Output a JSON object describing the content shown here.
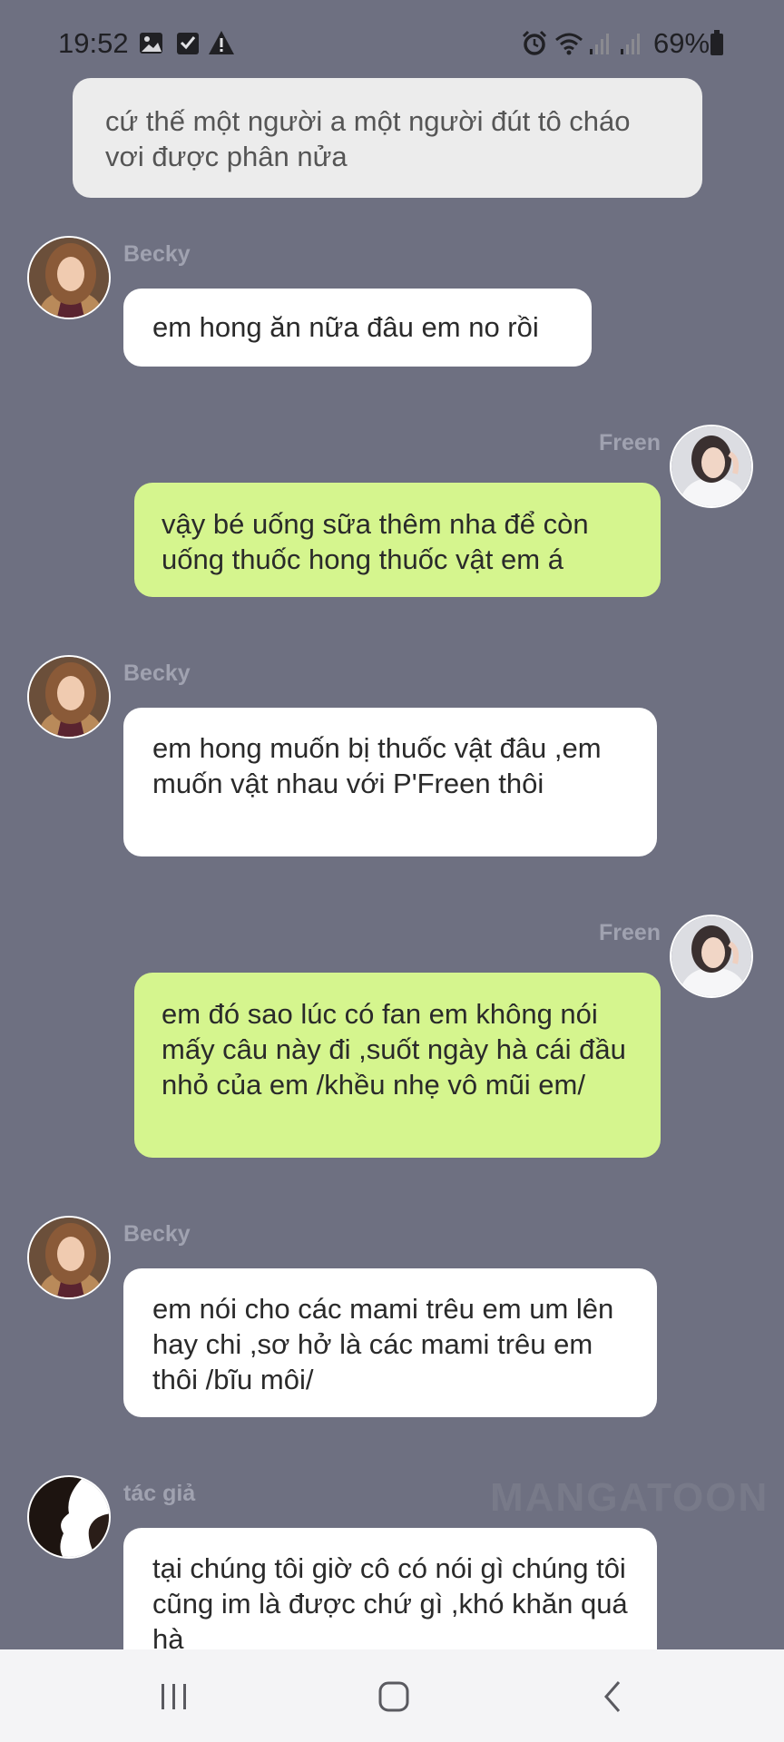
{
  "status_bar": {
    "time": "19:52",
    "battery": "69%",
    "icons_left": [
      "image-notification-icon",
      "checkbox-notification-icon",
      "warning-icon"
    ],
    "icons_right": [
      "alarm-icon",
      "wifi-icon",
      "signal-icon",
      "signal-icon",
      "battery-icon"
    ]
  },
  "messages": [
    {
      "type": "narration",
      "text": "cứ thế một người a một người đút tô cháo vơi được phân nửa"
    },
    {
      "type": "left",
      "sender": "Becky",
      "avatar": "becky-avatar",
      "text": "em hong ăn nữa đâu em no rồi"
    },
    {
      "type": "right",
      "sender": "Freen",
      "avatar": "freen-avatar",
      "text": "vậy bé uống sữa thêm nha để còn uống thuốc hong thuốc vật em á"
    },
    {
      "type": "left",
      "sender": "Becky",
      "avatar": "becky-avatar",
      "text": "em hong muốn bị thuốc vật đâu ,em muốn vật nhau với P'Freen thôi"
    },
    {
      "type": "right",
      "sender": "Freen",
      "avatar": "freen-avatar",
      "text": "em đó sao lúc có fan em không nói mấy câu này đi ,suốt ngày hà cái đầu nhỏ của em /khều nhẹ vô mũi em/"
    },
    {
      "type": "left",
      "sender": "Becky",
      "avatar": "becky-avatar",
      "text": "em nói cho các mami trêu em um lên hay chi ,sơ hở là các mami trêu em thôi /bĩu môi/"
    },
    {
      "type": "left",
      "sender": "tác giả",
      "avatar": "author-avatar",
      "text": "tại chúng tôi giờ cô có nói gì chúng tôi cũng im là được chứ gì ,khó khăn quá hà"
    }
  ],
  "watermark": "MANGATOON",
  "nav_bar": {
    "buttons": [
      "recent-apps-button",
      "home-button",
      "back-button"
    ]
  },
  "colors": {
    "background": "#6e7081",
    "bubble_left": "#ffffff",
    "bubble_right": "#d5f58e",
    "bubble_narration": "#ececec",
    "sender_name": "#a0a2b0"
  }
}
